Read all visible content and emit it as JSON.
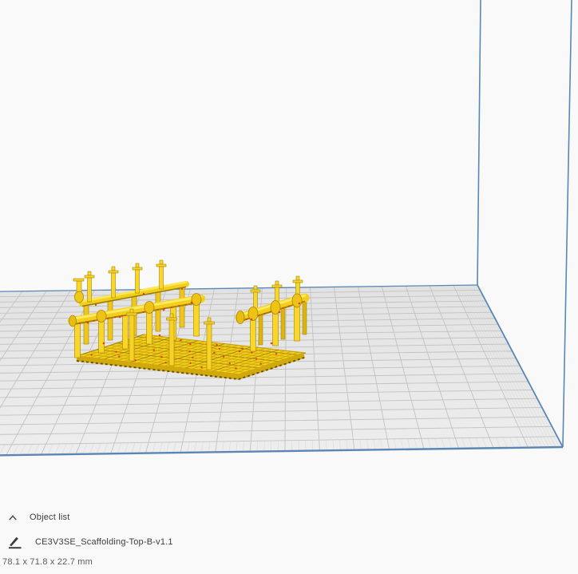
{
  "viewport": {
    "description": "3D build plate view",
    "model_color": "#f3cf1d",
    "overhang_color": "#e03a00",
    "bed_edge_color": "#5a86b6"
  },
  "object_list": {
    "collapse_icon": "chevron-up-icon",
    "title": "Object list",
    "items": [
      {
        "icon": "per-object-settings-icon",
        "name": "CE3V3SE_Scaffolding-Top-B-v1.1",
        "dimensions": "78.1 x 71.8 x 22.7 mm"
      }
    ]
  },
  "colors": {
    "background": "#f9f9f9",
    "plate_back": "#e2e2e2",
    "plate_front": "#eeeeee",
    "grid_major": "#c2c2c2",
    "grid_fine": "#d8d8d8",
    "bed_edge_blue": "#5a86b6",
    "model_yellow": "#f3cf1d",
    "model_highlight": "#ffe95c",
    "model_shadow": "#a98406",
    "overhang_red": "#e03a00",
    "text_dark": "#3c3c3c",
    "text_dim": "#5a5a5a"
  }
}
